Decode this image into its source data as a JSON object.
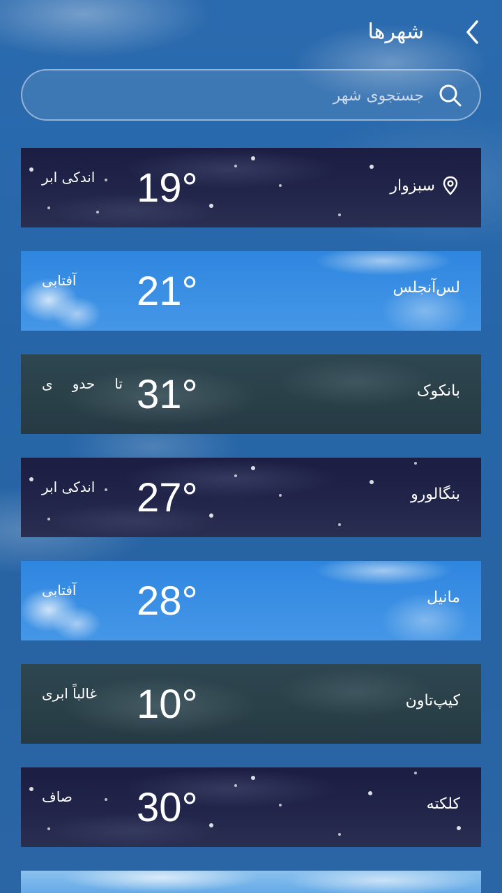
{
  "header": {
    "title": "شهرها"
  },
  "search": {
    "placeholder": "جستجوی شهر"
  },
  "cities": [
    {
      "name": "سبزوار",
      "temp": "19°",
      "condition": "اندکی ابر",
      "theme": "night",
      "current_location": true
    },
    {
      "name": "لس‌آنجلس",
      "temp": "21°",
      "condition": "آفتابی",
      "theme": "sunny"
    },
    {
      "name": "بانکوک",
      "temp": "31°",
      "condition": "تا حدو ی",
      "theme": "cloudy"
    },
    {
      "name": "بنگالورو",
      "temp": "27°",
      "condition": "اندکی ابر",
      "theme": "night"
    },
    {
      "name": "مانیل",
      "temp": "28°",
      "condition": "آفتابی",
      "theme": "sunny"
    },
    {
      "name": "کیپ‌تاون",
      "temp": "10°",
      "condition": "غالباً ابری",
      "theme": "cloudy"
    },
    {
      "name": "کلکته",
      "temp": "30°",
      "condition": "صاف",
      "theme": "night"
    }
  ],
  "icons": {
    "back": "chevron-left-icon",
    "search": "search-icon",
    "location": "location-pin-icon"
  },
  "colors": {
    "background": "#2766a8",
    "night_card": "#1e2146",
    "sunny_card": "#3a8fe4",
    "cloudy_card": "#2b424b"
  }
}
